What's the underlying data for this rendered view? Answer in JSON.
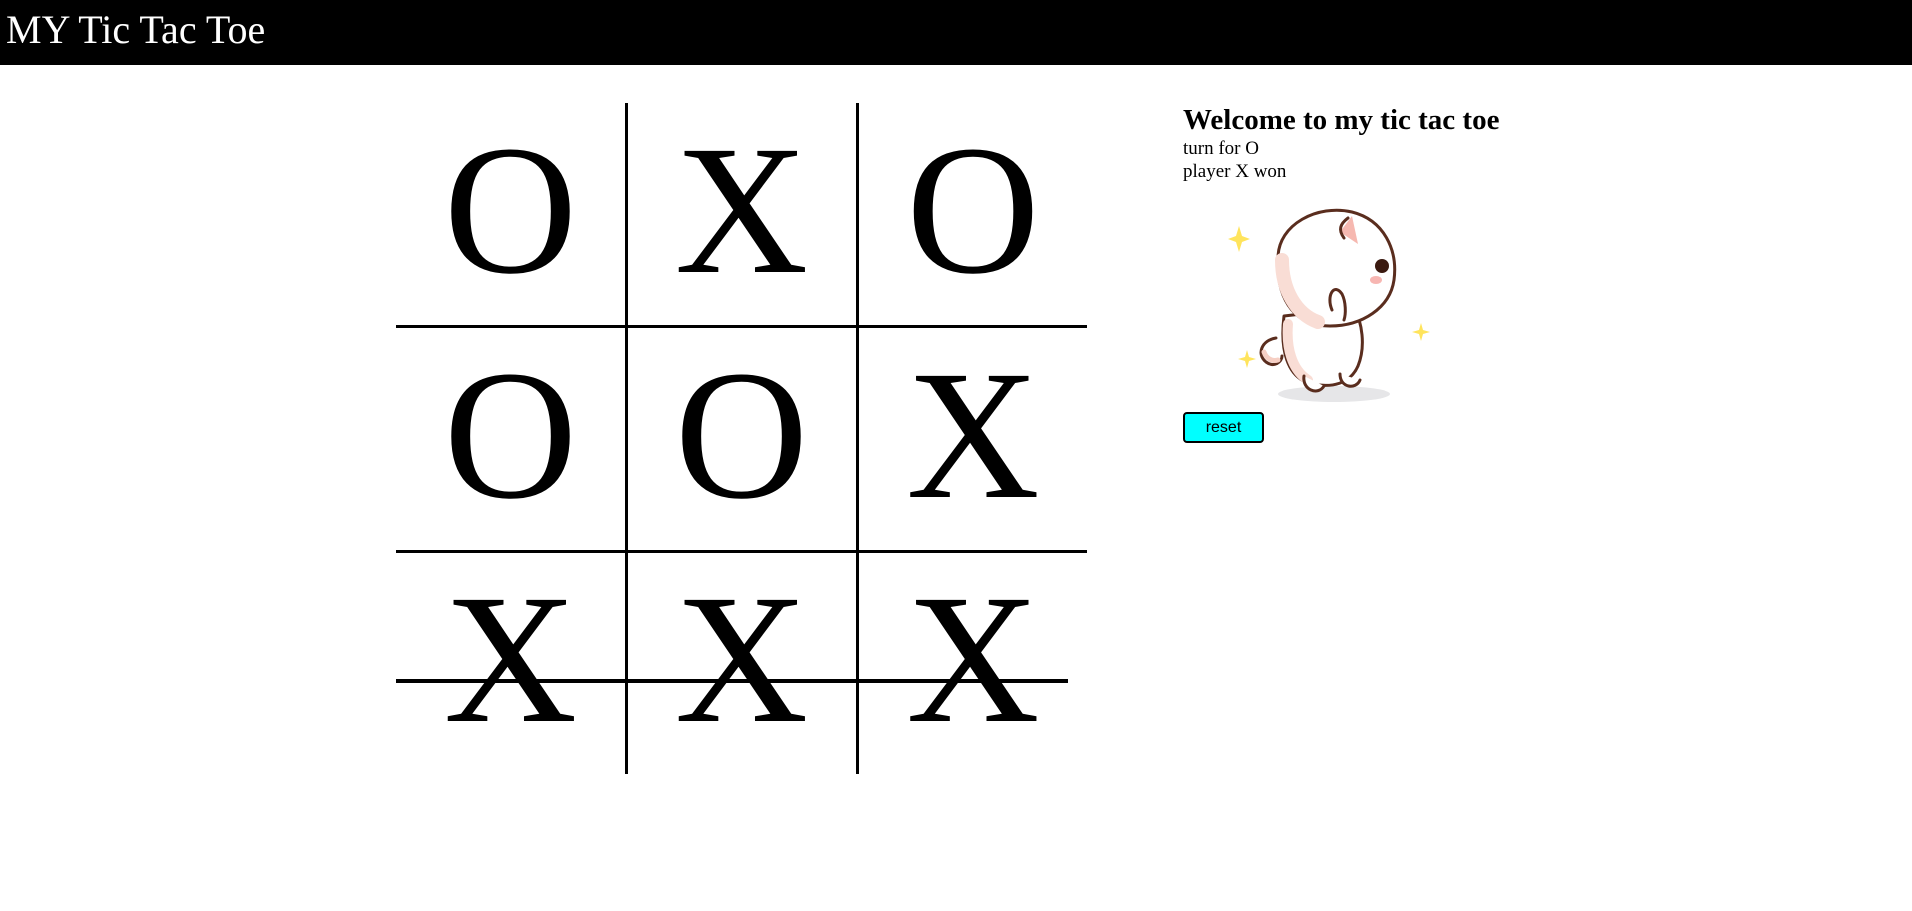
{
  "header": {
    "title": "MY Tic Tac Toe",
    "background": "#000000",
    "text_color": "#ffffff"
  },
  "board": {
    "cells": [
      [
        "O",
        "X",
        "O"
      ],
      [
        "O",
        "O",
        "X"
      ],
      [
        "X",
        "X",
        "X"
      ]
    ],
    "winning_row": 3
  },
  "info": {
    "welcome": "Welcome to my tic tac toe",
    "turn_text": "turn for O",
    "result_text": "player X won"
  },
  "image": {
    "icon": "cat-sticker-icon"
  },
  "reset": {
    "label": "reset",
    "color": "#00ffff"
  }
}
